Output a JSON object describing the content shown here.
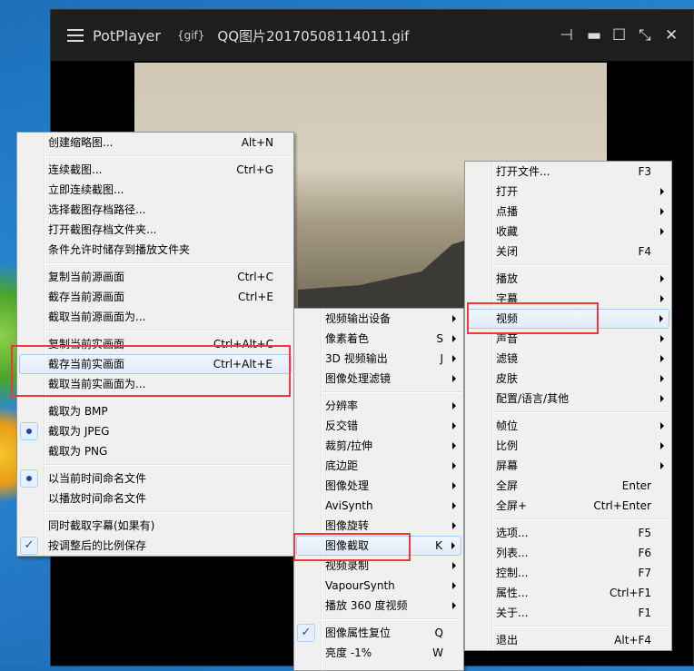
{
  "window": {
    "app_name": "PotPlayer",
    "format": "{gif}",
    "file_name": "QQ图片20170508114011.gif"
  },
  "menus": {
    "capture": [
      {
        "label": "创建缩略图...",
        "shortcut": "Alt+N"
      },
      {
        "sep": true
      },
      {
        "label": "连续截图...",
        "shortcut": "Ctrl+G"
      },
      {
        "label": "立即连续截图..."
      },
      {
        "label": "选择截图存档路径..."
      },
      {
        "label": "打开截图存档文件夹..."
      },
      {
        "label": "条件允许时储存到播放文件夹"
      },
      {
        "sep": true
      },
      {
        "label": "复制当前源画面",
        "shortcut": "Ctrl+C"
      },
      {
        "label": "截存当前源画面",
        "shortcut": "Ctrl+E"
      },
      {
        "label": "截取当前源画面为..."
      },
      {
        "sep": true
      },
      {
        "label": "复制当前实画面",
        "shortcut": "Ctrl+Alt+C"
      },
      {
        "label": "截存当前实画面",
        "shortcut": "Ctrl+Alt+E",
        "highlight": true
      },
      {
        "label": "截取当前实画面为..."
      },
      {
        "sep": true
      },
      {
        "label": "截取为 BMP"
      },
      {
        "label": "截取为 JPEG",
        "radio": true
      },
      {
        "label": "截取为 PNG"
      },
      {
        "sep": true
      },
      {
        "label": "以当前时间命名文件",
        "radio": true
      },
      {
        "label": "以播放时间命名文件"
      },
      {
        "sep": true
      },
      {
        "label": "同时截取字幕(如果有)"
      },
      {
        "label": "按调整后的比例保存",
        "check": true
      }
    ],
    "video": [
      {
        "label": "视频输出设备",
        "sub": true
      },
      {
        "label": "像素着色",
        "shortcut": "S",
        "sub": true
      },
      {
        "label": "3D 视频输出",
        "shortcut": "J",
        "sub": true
      },
      {
        "label": "图像处理滤镜",
        "sub": true
      },
      {
        "sep": true
      },
      {
        "label": "分辨率",
        "sub": true
      },
      {
        "label": "反交错",
        "sub": true
      },
      {
        "label": "裁剪/拉伸",
        "sub": true
      },
      {
        "label": "底边距",
        "sub": true
      },
      {
        "label": "图像处理",
        "sub": true
      },
      {
        "label": "AviSynth",
        "sub": true
      },
      {
        "label": "图像旋转",
        "sub": true
      },
      {
        "label": "图像截取",
        "shortcut": "K",
        "sub": true,
        "highlight": true
      },
      {
        "label": "视频录制",
        "sub": true
      },
      {
        "label": "VapourSynth",
        "sub": true
      },
      {
        "label": "播放 360 度视频",
        "sub": true
      },
      {
        "sep": true
      },
      {
        "label": "图像属性复位",
        "shortcut": "Q",
        "check": true
      },
      {
        "label": "亮度 -1%",
        "shortcut": "W"
      }
    ],
    "main": [
      {
        "label": "打开文件...",
        "shortcut": "F3"
      },
      {
        "label": "打开",
        "sub": true
      },
      {
        "label": "点播",
        "sub": true
      },
      {
        "label": "收藏",
        "sub": true
      },
      {
        "label": "关闭",
        "shortcut": "F4"
      },
      {
        "sep": true
      },
      {
        "label": "播放",
        "sub": true
      },
      {
        "label": "字幕",
        "sub": true
      },
      {
        "label": "视频",
        "sub": true,
        "highlight": true
      },
      {
        "label": "声音",
        "sub": true
      },
      {
        "label": "滤镜",
        "sub": true
      },
      {
        "label": "皮肤",
        "sub": true
      },
      {
        "label": "配置/语言/其他",
        "sub": true
      },
      {
        "sep": true
      },
      {
        "label": "帧位",
        "sub": true
      },
      {
        "label": "比例",
        "sub": true
      },
      {
        "label": "屏幕",
        "sub": true
      },
      {
        "label": "全屏",
        "shortcut": "Enter"
      },
      {
        "label": "全屏+",
        "shortcut": "Ctrl+Enter"
      },
      {
        "sep": true
      },
      {
        "label": "选项...",
        "shortcut": "F5"
      },
      {
        "label": "列表...",
        "shortcut": "F6"
      },
      {
        "label": "控制...",
        "shortcut": "F7"
      },
      {
        "label": "属性...",
        "shortcut": "Ctrl+F1"
      },
      {
        "label": "关于...",
        "shortcut": "F1"
      },
      {
        "sep": true
      },
      {
        "label": "退出",
        "shortcut": "Alt+F4"
      }
    ]
  },
  "colors": {
    "highlight_box": "#f0383c",
    "title_bar": "#1e1e1e"
  }
}
